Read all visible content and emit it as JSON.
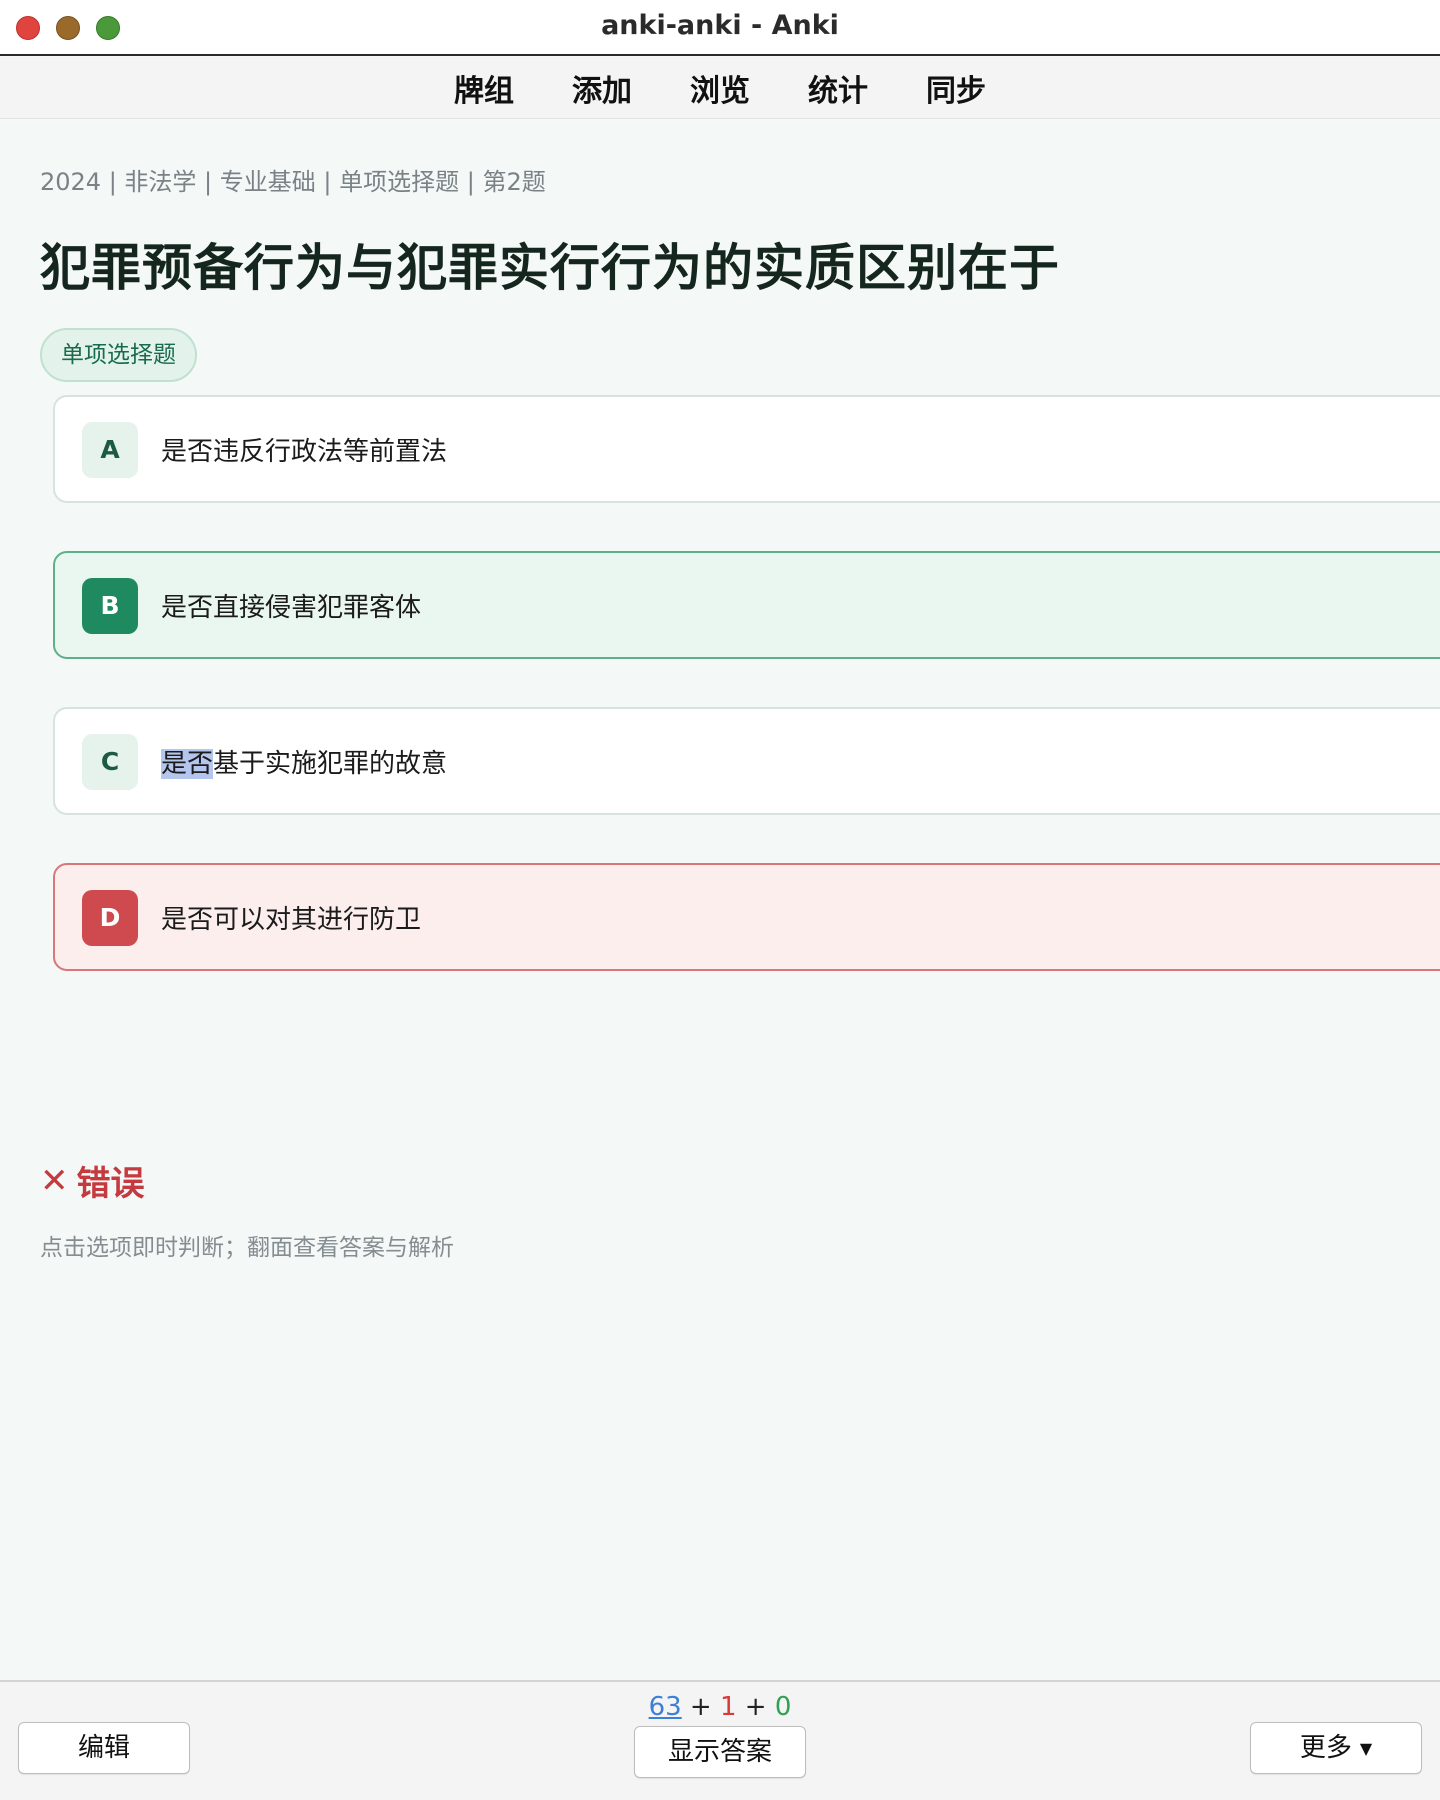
{
  "window": {
    "title": "anki-anki - Anki"
  },
  "toolbar": {
    "items": [
      "牌组",
      "添加",
      "浏览",
      "统计",
      "同步"
    ]
  },
  "card": {
    "breadcrumb": "2024 | 非法学 | 专业基础 | 单项选择题 | 第2题",
    "question": "犯罪预备行为与犯罪实行行为的实质区别在于",
    "tag": "单项选择题",
    "options": [
      {
        "letter": "A",
        "text": "是否违反行政法等前置法",
        "state": "default"
      },
      {
        "letter": "B",
        "text": "是否直接侵害犯罪客体",
        "state": "correct"
      },
      {
        "letter": "C",
        "text_selected": "是否",
        "text_rest": "基于实施犯罪的故意",
        "state": "default"
      },
      {
        "letter": "D",
        "text": "是否可以对其进行防卫",
        "state": "wrong"
      }
    ],
    "verdict": {
      "icon": "✕",
      "label": "错误"
    },
    "hint": "点击选项即时判断；翻面查看答案与解析"
  },
  "bottombar": {
    "counts": {
      "new": "63",
      "sep1": " + ",
      "learn": "1",
      "sep2": " + ",
      "review": "0"
    },
    "edit_label": "编辑",
    "show_answer_label": "显示答案",
    "more_label": "更多"
  },
  "colors": {
    "correct": "#1f8a60",
    "wrong": "#cf4a4e",
    "new_count": "#3b7fd8",
    "learn_count": "#d8393b",
    "review_count": "#2ea152"
  }
}
